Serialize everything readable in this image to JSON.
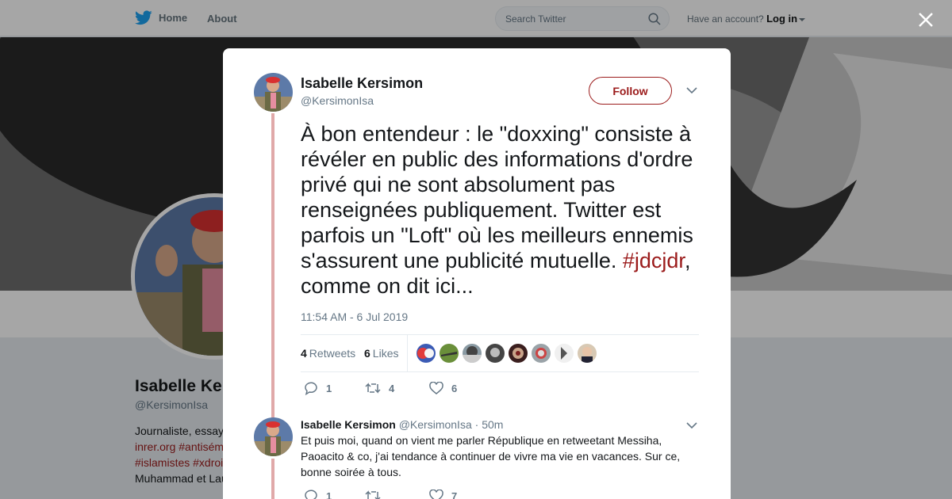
{
  "nav": {
    "home_label": "Home",
    "about_label": "About",
    "search_placeholder": "Search Twitter",
    "account_prompt": "Have an account?",
    "login_label": "Log in"
  },
  "profile": {
    "name": "Isabelle Kersimon",
    "handle": "@KersimonIsa",
    "bio_lines": [
      "Journaliste, essay",
      "inrer.org #antisém",
      "#islamistes #xdroi",
      "Muhammad et Lau"
    ]
  },
  "tweet": {
    "author_name": "Isabelle Kersimon",
    "author_handle": "@KersimonIsa",
    "follow_label": "Follow",
    "text_before": "À bon entendeur : le \"doxxing\" consiste à révéler en public des informations d'ordre privé qui ne sont absolument pas renseignées publiquement. Twitter est parfois un \"Loft\" où les meilleurs ennemis s'assurent une publicité mutuelle. ",
    "hashtag": "#jdcjdr",
    "text_after": ", comme on dit ici...",
    "timestamp": "11:54 AM - 6 Jul 2019",
    "retweets_count": "4",
    "retweets_label": "Retweets",
    "likes_count": "6",
    "likes_label": "Likes",
    "reply_count": "1",
    "retweet_action_count": "4",
    "like_action_count": "6"
  },
  "reply": {
    "author_name": "Isabelle Kersimon",
    "author_handle": "@KersimonIsa",
    "time": "· 50m",
    "text": "Et puis moi, quand on vient me parler République en retweetant Messiha, Paoacito & co, j'ai tendance à continuer de vivre ma vie en vacances. Sur ce, bonne soirée à tous.",
    "reply_count": "1",
    "like_count": "7"
  },
  "colors": {
    "accent": "#9b1b1b",
    "twitter_blue": "#1da1f2",
    "muted": "#657786"
  }
}
